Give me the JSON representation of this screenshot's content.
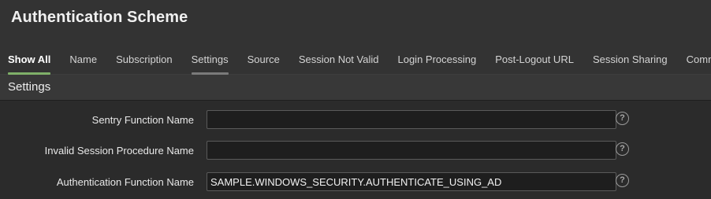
{
  "header": {
    "title": "Authentication Scheme"
  },
  "tabs": [
    {
      "label": "Show All",
      "active": true
    },
    {
      "label": "Name"
    },
    {
      "label": "Subscription"
    },
    {
      "label": "Settings"
    },
    {
      "label": "Source"
    },
    {
      "label": "Session Not Valid"
    },
    {
      "label": "Login Processing"
    },
    {
      "label": "Post-Logout URL"
    },
    {
      "label": "Session Sharing"
    },
    {
      "label": "Comments"
    }
  ],
  "section": {
    "title": "Settings"
  },
  "fields": [
    {
      "label": "Sentry Function Name",
      "value": "",
      "help_icon": "question-circle-icon"
    },
    {
      "label": "Invalid Session Procedure Name",
      "value": "",
      "help_icon": "question-circle-icon"
    },
    {
      "label": "Authentication Function Name",
      "value": "SAMPLE.WINDOWS_SECURITY.AUTHENTICATE_USING_AD",
      "help_icon": "question-circle-icon"
    }
  ],
  "colors": {
    "active_tab_underline": "#7fb069",
    "settings_tab_underline": "#7a7a7a"
  }
}
